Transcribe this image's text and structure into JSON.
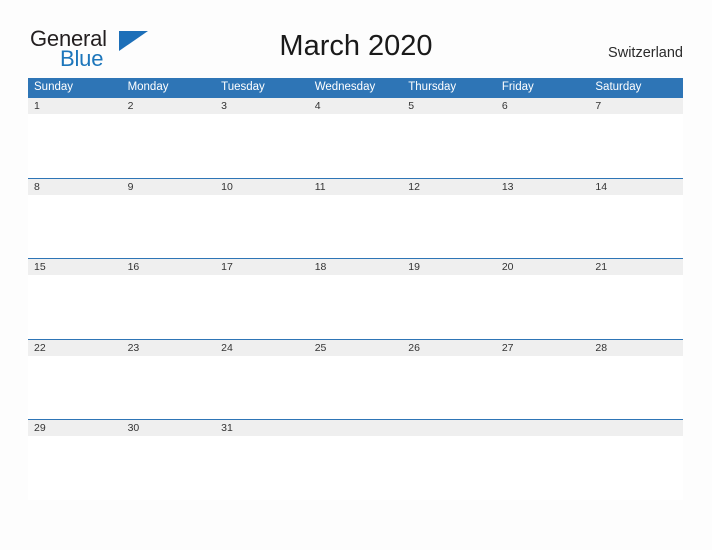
{
  "page": {
    "background_color": "#fdfdfd",
    "accent_color": "#2e75b6",
    "band_color": "#efefef"
  },
  "logo": {
    "text_primary": "General",
    "text_secondary": "Blue",
    "flag_icon": "blue-triangle-flag-icon"
  },
  "header": {
    "title": "March 2020",
    "country": "Switzerland"
  },
  "calendar": {
    "weekdays": [
      "Sunday",
      "Monday",
      "Tuesday",
      "Wednesday",
      "Thursday",
      "Friday",
      "Saturday"
    ],
    "weeks": [
      {
        "days": [
          "1",
          "2",
          "3",
          "4",
          "5",
          "6",
          "7"
        ]
      },
      {
        "days": [
          "8",
          "9",
          "10",
          "11",
          "12",
          "13",
          "14"
        ]
      },
      {
        "days": [
          "15",
          "16",
          "17",
          "18",
          "19",
          "20",
          "21"
        ]
      },
      {
        "days": [
          "22",
          "23",
          "24",
          "25",
          "26",
          "27",
          "28"
        ]
      },
      {
        "days": [
          "29",
          "30",
          "31",
          "",
          "",
          "",
          ""
        ]
      }
    ]
  }
}
